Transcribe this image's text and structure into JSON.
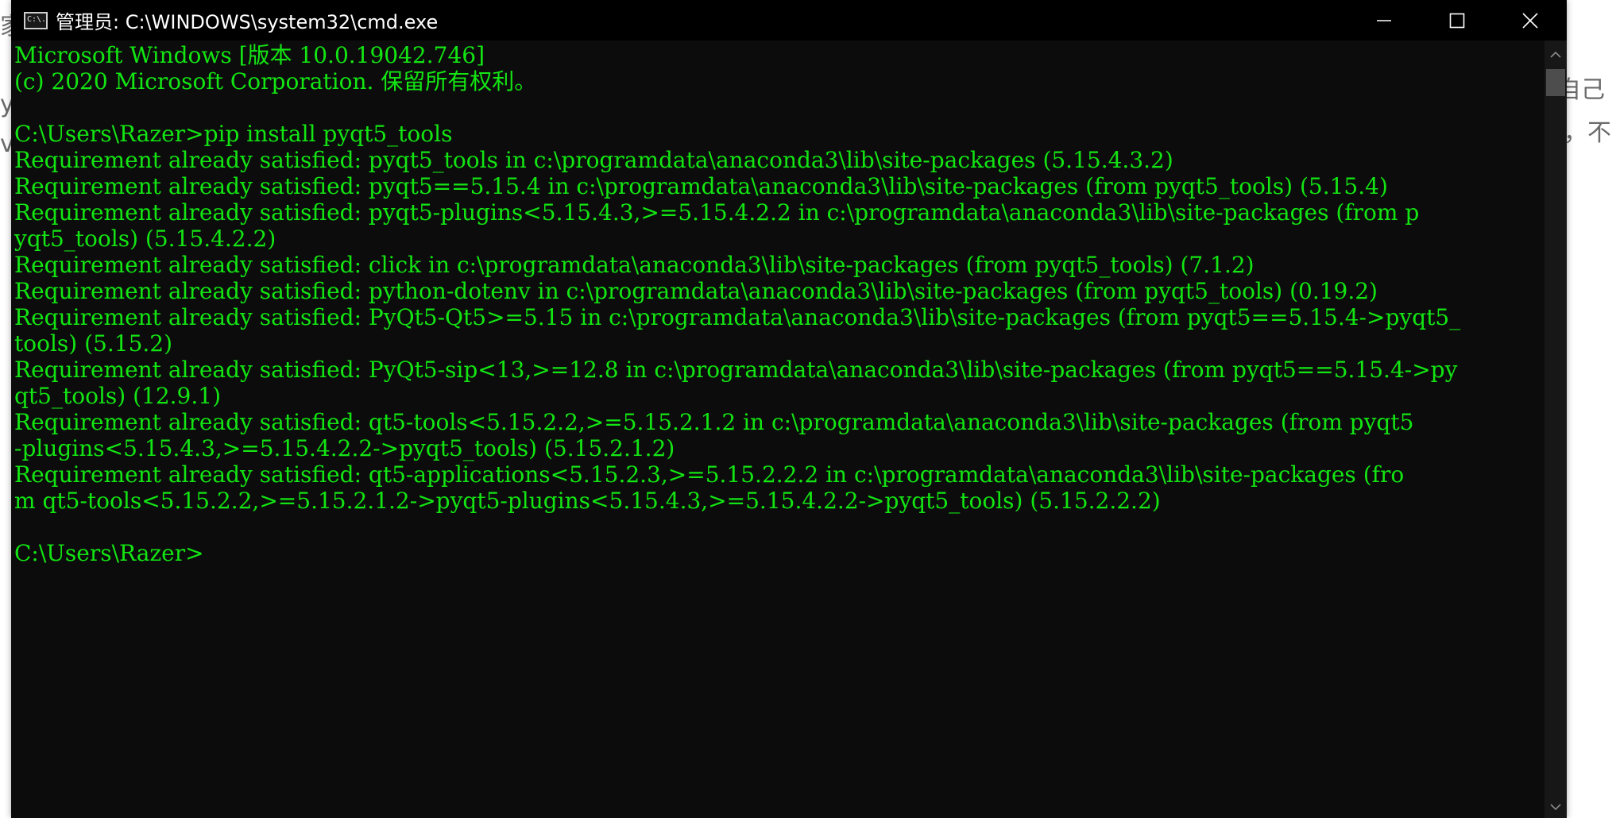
{
  "window": {
    "title": "管理员: C:\\WINDOWS\\system32\\cmd.exe",
    "app_icon_text": "C:\\."
  },
  "controls": {
    "minimize_icon": "minimize-icon",
    "maximize_icon": "maximize-icon",
    "close_icon": "close-icon"
  },
  "background": {
    "right_text_1": "自己",
    "right_text_2": "，不",
    "left_text_1": "家",
    "left_text_2": "y",
    "left_text_3": "vi"
  },
  "console": {
    "lines": [
      "Microsoft Windows [版本 10.0.19042.746]",
      "(c) 2020 Microsoft Corporation. 保留所有权利。",
      "",
      "C:\\Users\\Razer>pip install pyqt5_tools",
      "Requirement already satisfied: pyqt5_tools in c:\\programdata\\anaconda3\\lib\\site-packages (5.15.4.3.2)",
      "Requirement already satisfied: pyqt5==5.15.4 in c:\\programdata\\anaconda3\\lib\\site-packages (from pyqt5_tools) (5.15.4)",
      "Requirement already satisfied: pyqt5-plugins<5.15.4.3,>=5.15.4.2.2 in c:\\programdata\\anaconda3\\lib\\site-packages (from p",
      "yqt5_tools) (5.15.4.2.2)",
      "Requirement already satisfied: click in c:\\programdata\\anaconda3\\lib\\site-packages (from pyqt5_tools) (7.1.2)",
      "Requirement already satisfied: python-dotenv in c:\\programdata\\anaconda3\\lib\\site-packages (from pyqt5_tools) (0.19.2)",
      "Requirement already satisfied: PyQt5-Qt5>=5.15 in c:\\programdata\\anaconda3\\lib\\site-packages (from pyqt5==5.15.4->pyqt5_",
      "tools) (5.15.2)",
      "Requirement already satisfied: PyQt5-sip<13,>=12.8 in c:\\programdata\\anaconda3\\lib\\site-packages (from pyqt5==5.15.4->py",
      "qt5_tools) (12.9.1)",
      "Requirement already satisfied: qt5-tools<5.15.2.2,>=5.15.2.1.2 in c:\\programdata\\anaconda3\\lib\\site-packages (from pyqt5",
      "-plugins<5.15.4.3,>=5.15.4.2.2->pyqt5_tools) (5.15.2.1.2)",
      "Requirement already satisfied: qt5-applications<5.15.2.3,>=5.15.2.2.2 in c:\\programdata\\anaconda3\\lib\\site-packages (fro",
      "m qt5-tools<5.15.2.2,>=5.15.2.1.2->pyqt5-plugins<5.15.4.3,>=5.15.4.2.2->pyqt5_tools) (5.15.2.2.2)",
      "",
      "C:\\Users\\Razer>"
    ]
  },
  "colors": {
    "console_bg": "#0c0c0c",
    "console_text": "#13e513",
    "titlebar_bg": "#000000",
    "scrollbar_bg": "#171717",
    "scrollbar_thumb": "#4d4d4d"
  }
}
